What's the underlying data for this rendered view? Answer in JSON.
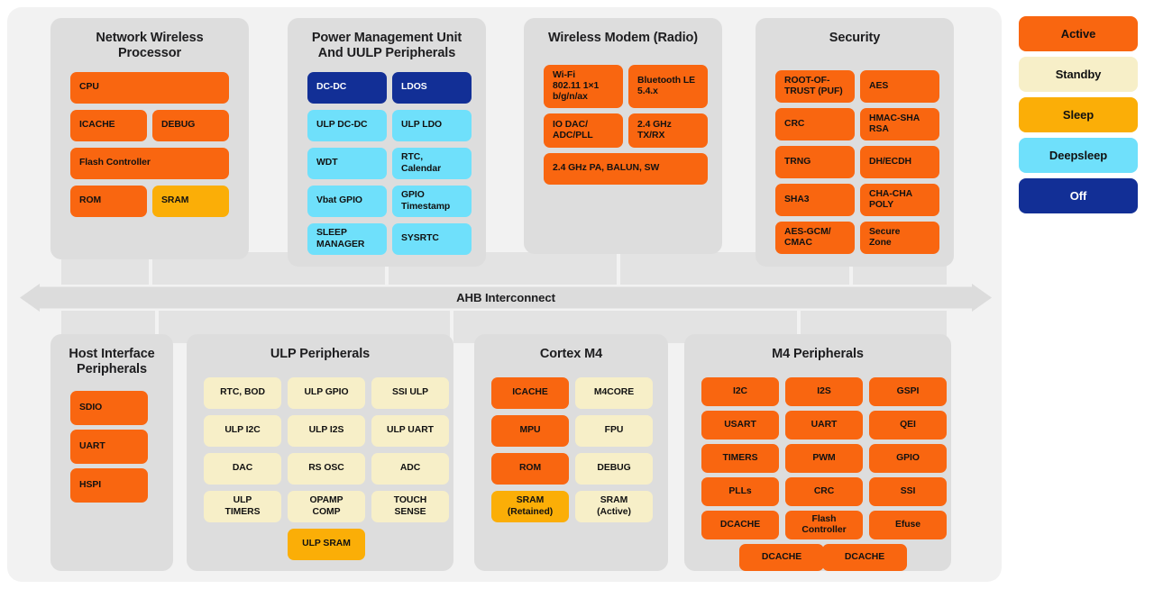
{
  "bus": {
    "label": "AHB Interconnect"
  },
  "legend": {
    "items": [
      {
        "label": "Active",
        "state": "active",
        "color": "#f96610"
      },
      {
        "label": "Standby",
        "state": "standby",
        "color": "#f7efc8"
      },
      {
        "label": "Sleep",
        "state": "sleep",
        "color": "#fbae07"
      },
      {
        "label": "Deepsleep",
        "state": "deepsleep",
        "color": "#6fe0fb"
      },
      {
        "label": "Off",
        "state": "off",
        "color": "#122f96"
      }
    ]
  },
  "groups": {
    "nwp": {
      "title": "Network Wireless\nProcessor",
      "blocks": [
        {
          "label": "CPU",
          "state": "active"
        },
        {
          "label": "ICACHE",
          "state": "active"
        },
        {
          "label": "DEBUG",
          "state": "active"
        },
        {
          "label": "Flash Controller",
          "state": "active"
        },
        {
          "label": "ROM",
          "state": "active"
        },
        {
          "label": "SRAM",
          "state": "sleep"
        }
      ]
    },
    "pmu": {
      "title": "Power Management Unit\nAnd UULP Peripherals",
      "blocks": [
        {
          "label": "DC-DC",
          "state": "off"
        },
        {
          "label": "LDOS",
          "state": "off"
        },
        {
          "label": "ULP DC-DC",
          "state": "deepsleep"
        },
        {
          "label": "ULP LDO",
          "state": "deepsleep"
        },
        {
          "label": "WDT",
          "state": "deepsleep"
        },
        {
          "label": "RTC,\nCalendar",
          "state": "deepsleep"
        },
        {
          "label": "Vbat GPIO",
          "state": "deepsleep"
        },
        {
          "label": "GPIO\nTimestamp",
          "state": "deepsleep"
        },
        {
          "label": "SLEEP\nMANAGER",
          "state": "deepsleep"
        },
        {
          "label": "SYSRTC",
          "state": "deepsleep"
        }
      ]
    },
    "modem": {
      "title": "Wireless Modem (Radio)",
      "blocks": [
        {
          "label": "Wi-Fi\n802.11 1×1\nb/g/n/ax",
          "state": "active"
        },
        {
          "label": "Bluetooth LE\n5.4.x",
          "state": "active"
        },
        {
          "label": "IO DAC/\nADC/PLL",
          "state": "active"
        },
        {
          "label": "2.4 GHz\nTX/RX",
          "state": "active"
        },
        {
          "label": "2.4 GHz PA, BALUN, SW",
          "state": "active"
        }
      ]
    },
    "security": {
      "title": "Security",
      "blocks": [
        {
          "label": "ROOT-OF-\nTRUST (PUF)",
          "state": "active"
        },
        {
          "label": "AES",
          "state": "active"
        },
        {
          "label": "CRC",
          "state": "active"
        },
        {
          "label": "HMAC-SHA\nRSA",
          "state": "active"
        },
        {
          "label": "TRNG",
          "state": "active"
        },
        {
          "label": "DH/ECDH",
          "state": "active"
        },
        {
          "label": "SHA3",
          "state": "active"
        },
        {
          "label": "CHA-CHA\nPOLY",
          "state": "active"
        },
        {
          "label": "AES-GCM/\nCMAC",
          "state": "active"
        },
        {
          "label": "Secure\nZone",
          "state": "active"
        }
      ]
    },
    "host": {
      "title": "Host Interface\nPeripherals",
      "blocks": [
        {
          "label": "SDIO",
          "state": "active"
        },
        {
          "label": "UART",
          "state": "active"
        },
        {
          "label": "HSPI",
          "state": "active"
        }
      ]
    },
    "ulp": {
      "title": "ULP Peripherals",
      "blocks": [
        {
          "label": "RTC, BOD",
          "state": "standby"
        },
        {
          "label": "ULP GPIO",
          "state": "standby"
        },
        {
          "label": "SSI ULP",
          "state": "standby"
        },
        {
          "label": "ULP I2C",
          "state": "standby"
        },
        {
          "label": "ULP I2S",
          "state": "standby"
        },
        {
          "label": "ULP UART",
          "state": "standby"
        },
        {
          "label": "DAC",
          "state": "standby"
        },
        {
          "label": "RS OSC",
          "state": "standby"
        },
        {
          "label": "ADC",
          "state": "standby"
        },
        {
          "label": "ULP\nTIMERS",
          "state": "standby"
        },
        {
          "label": "OPAMP\nCOMP",
          "state": "standby"
        },
        {
          "label": "TOUCH\nSENSE",
          "state": "standby"
        },
        {
          "label": "ULP SRAM",
          "state": "sleep"
        }
      ]
    },
    "cortex": {
      "title": "Cortex M4",
      "blocks": [
        {
          "label": "ICACHE",
          "state": "active"
        },
        {
          "label": "M4CORE",
          "state": "standby"
        },
        {
          "label": "MPU",
          "state": "active"
        },
        {
          "label": "FPU",
          "state": "standby"
        },
        {
          "label": "ROM",
          "state": "active"
        },
        {
          "label": "DEBUG",
          "state": "standby"
        },
        {
          "label": "SRAM\n(Retained)",
          "state": "sleep"
        },
        {
          "label": "SRAM\n(Active)",
          "state": "standby"
        }
      ]
    },
    "m4p": {
      "title": "M4 Peripherals",
      "blocks": [
        {
          "label": "I2C",
          "state": "active"
        },
        {
          "label": "I2S",
          "state": "active"
        },
        {
          "label": "GSPI",
          "state": "active"
        },
        {
          "label": "USART",
          "state": "active"
        },
        {
          "label": "UART",
          "state": "active"
        },
        {
          "label": "QEI",
          "state": "active"
        },
        {
          "label": "TIMERS",
          "state": "active"
        },
        {
          "label": "PWM",
          "state": "active"
        },
        {
          "label": "GPIO",
          "state": "active"
        },
        {
          "label": "PLLs",
          "state": "active"
        },
        {
          "label": "CRC",
          "state": "active"
        },
        {
          "label": "SSI",
          "state": "active"
        },
        {
          "label": "DCACHE",
          "state": "active"
        },
        {
          "label": "Flash\nController",
          "state": "active"
        },
        {
          "label": "Efuse",
          "state": "active"
        },
        {
          "label": "DCACHE",
          "state": "active"
        },
        {
          "label": "DCACHE",
          "state": "active"
        }
      ]
    }
  }
}
